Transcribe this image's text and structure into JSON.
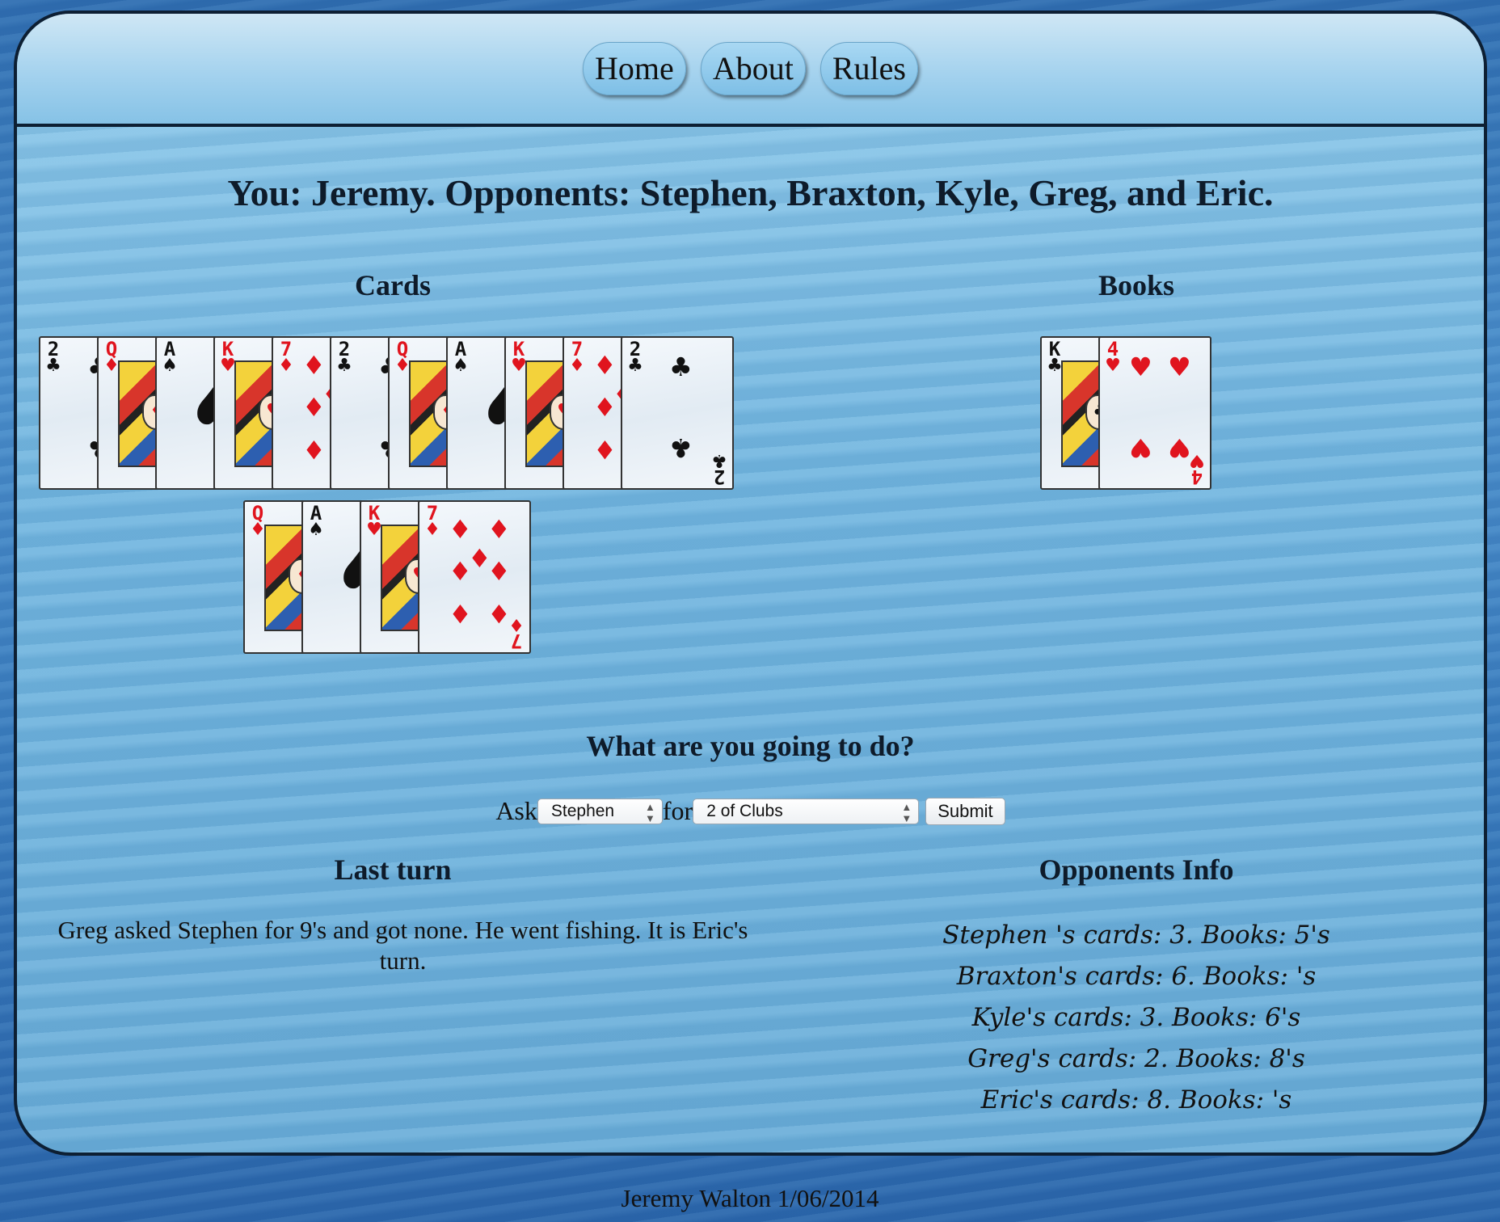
{
  "nav": {
    "items": [
      {
        "label": "Home"
      },
      {
        "label": "About"
      },
      {
        "label": "Rules"
      }
    ]
  },
  "player_line": "You: Jeremy. Opponents: Stephen, Braxton, Kyle, Greg, and Eric.",
  "cards_title": "Cards",
  "books_title": "Books",
  "hand": [
    {
      "rank": "2",
      "suit": "clubs"
    },
    {
      "rank": "Q",
      "suit": "diamonds"
    },
    {
      "rank": "A",
      "suit": "spades"
    },
    {
      "rank": "K",
      "suit": "hearts"
    },
    {
      "rank": "7",
      "suit": "diamonds"
    },
    {
      "rank": "2",
      "suit": "clubs"
    },
    {
      "rank": "Q",
      "suit": "diamonds"
    },
    {
      "rank": "A",
      "suit": "spades"
    },
    {
      "rank": "K",
      "suit": "hearts"
    },
    {
      "rank": "7",
      "suit": "diamonds"
    },
    {
      "rank": "2",
      "suit": "clubs"
    },
    {
      "rank": "Q",
      "suit": "diamonds"
    },
    {
      "rank": "A",
      "suit": "spades"
    },
    {
      "rank": "K",
      "suit": "hearts"
    },
    {
      "rank": "7",
      "suit": "diamonds"
    }
  ],
  "books": [
    {
      "rank": "K",
      "suit": "clubs"
    },
    {
      "rank": "4",
      "suit": "hearts"
    }
  ],
  "suit_colors": {
    "red": "#e0141e",
    "black": "#111111"
  },
  "prompt": "What are you going to do?",
  "ask": {
    "ask_label": "Ask",
    "for_label": "for",
    "opponent_selected": "Stephen",
    "card_selected": "2 of Clubs",
    "submit_label": "Submit"
  },
  "last_turn": {
    "title": "Last turn",
    "text": "Greg asked Stephen for 9's and got none. He went fishing. It is Eric's turn."
  },
  "opponents_info": {
    "title": "Opponents Info",
    "lines": [
      "Stephen 's cards: 3. Books: 5's",
      "Braxton's cards: 6. Books: 's",
      "Kyle's cards: 3. Books: 6's",
      "Greg's cards: 2. Books: 8's",
      "Eric's cards: 8. Books: 's"
    ]
  },
  "footer": "Jeremy Walton 1/06/2014"
}
